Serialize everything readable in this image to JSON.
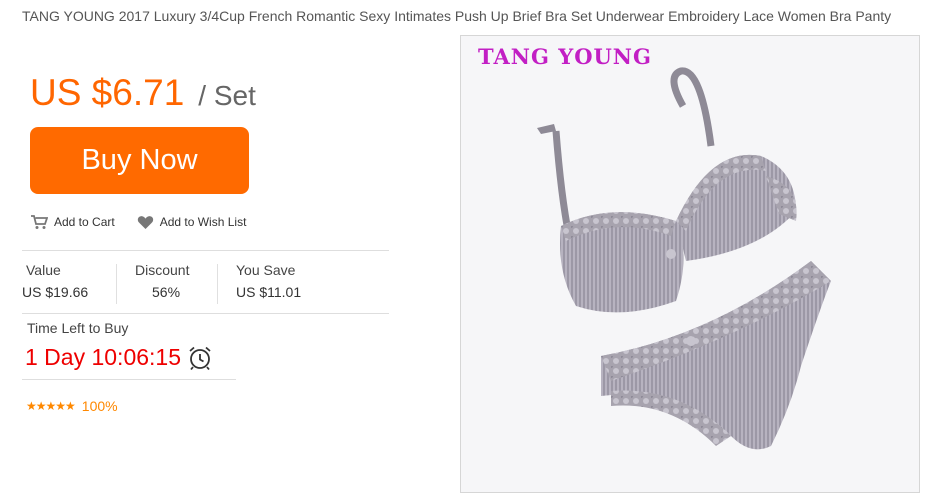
{
  "product": {
    "title": "TANG YOUNG 2017 Luxury 3/4Cup French Romantic Sexy Intimates Push Up Brief Bra Set Underwear Embroidery Lace Women Bra Panty",
    "price": "US $6.71",
    "unit": "/ Set",
    "brand_watermark": "TANG YOUNG"
  },
  "buttons": {
    "buy_now": "Buy Now",
    "add_to_cart": "Add to Cart",
    "add_to_wishlist": "Add to Wish List"
  },
  "stats": {
    "value_label": "Value",
    "value": "US $19.66",
    "discount_label": "Discount",
    "discount": "56%",
    "save_label": "You Save",
    "save": "US $11.01"
  },
  "timer": {
    "label": "Time Left to Buy",
    "value": "1 Day 10:06:15"
  },
  "rating": {
    "stars": 5,
    "percent": "100%"
  },
  "colors": {
    "price": "#ff6600",
    "button": "#ff6a00",
    "timer": "#ee0000",
    "brand": "#c21fc4"
  },
  "icons": [
    "cart-icon",
    "heart-icon",
    "alarm-clock-icon",
    "star-icon"
  ]
}
